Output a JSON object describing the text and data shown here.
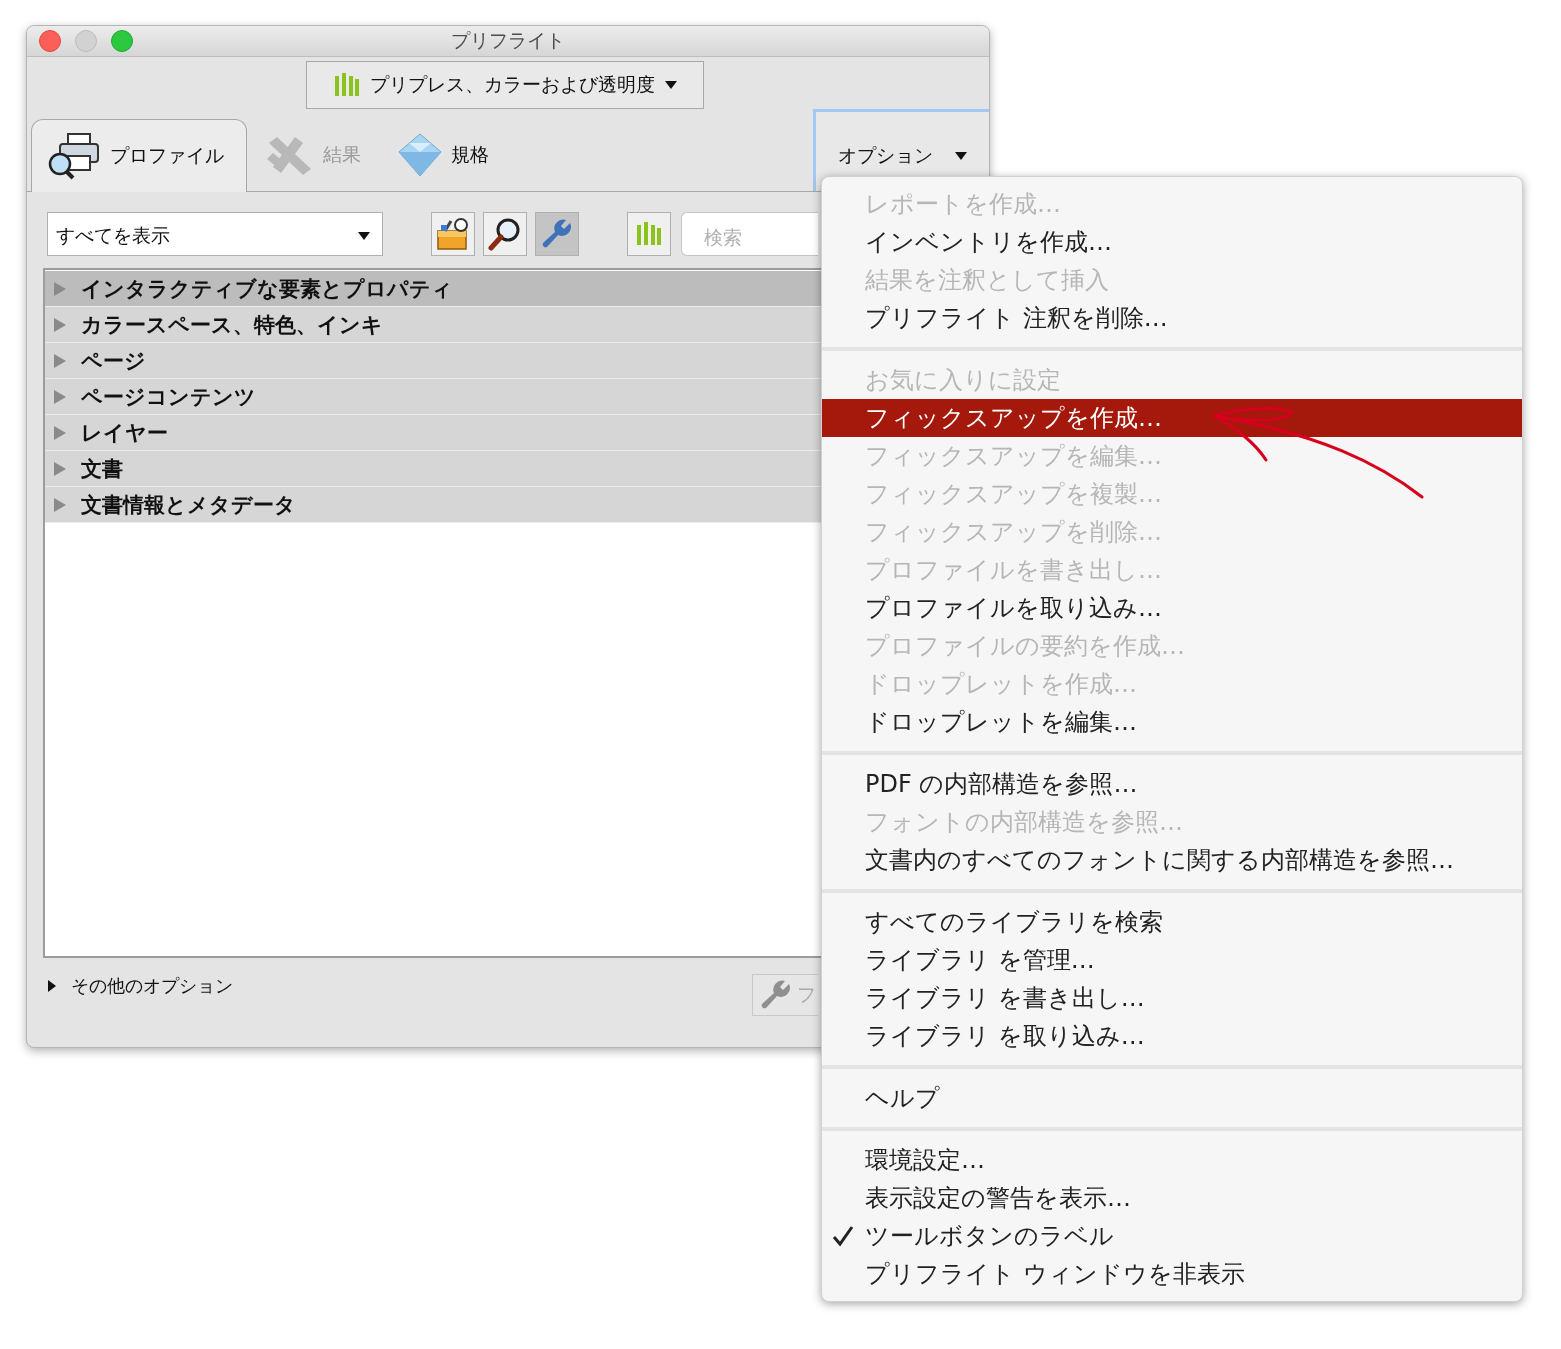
{
  "window": {
    "title": "プリフライト"
  },
  "library_selector": {
    "label": "プリプレス、カラーおよび透明度"
  },
  "tabs": [
    {
      "kind": "profiles",
      "label": "プロファイル",
      "selected": true,
      "disabled": false
    },
    {
      "kind": "results",
      "label": "結果",
      "selected": false,
      "disabled": true
    },
    {
      "kind": "standards",
      "label": "規格",
      "selected": false,
      "disabled": false
    }
  ],
  "options_button": {
    "label": "オプション",
    "expanded": true
  },
  "filter": {
    "value": "すべてを表示"
  },
  "tool_buttons": [
    {
      "kind": "toolbox",
      "selected": false
    },
    {
      "kind": "magnifier",
      "selected": false
    },
    {
      "kind": "wrench",
      "selected": true
    }
  ],
  "search": {
    "placeholder": "検索"
  },
  "tree": [
    {
      "label": "インタラクティブな要素とプロパティ",
      "selected": true
    },
    {
      "label": "カラースペース、特色、インキ",
      "selected": false
    },
    {
      "label": "ページ",
      "selected": false
    },
    {
      "label": "ページコンテンツ",
      "selected": false
    },
    {
      "label": "レイヤー",
      "selected": false
    },
    {
      "label": "文書",
      "selected": false
    },
    {
      "label": "文書情報とメタデータ",
      "selected": false
    }
  ],
  "more_options": {
    "label": "その他のオプション",
    "expanded": false
  },
  "bottom_button": {
    "label": "フ"
  },
  "menu": {
    "sections": [
      {
        "items": [
          {
            "label": "レポートを作成…",
            "disabled": true,
            "selected": false,
            "checked": false
          },
          {
            "label": "インベントリを作成…",
            "disabled": false,
            "selected": false,
            "checked": false
          },
          {
            "label": "結果を注釈として挿入",
            "disabled": true,
            "selected": false,
            "checked": false
          },
          {
            "label": "プリフライト 注釈を削除…",
            "disabled": false,
            "selected": false,
            "checked": false
          }
        ]
      },
      {
        "items": [
          {
            "label": "お気に入りに設定",
            "disabled": true,
            "selected": false,
            "checked": false
          },
          {
            "label": "フィックスアップを作成…",
            "disabled": false,
            "selected": true,
            "checked": false
          },
          {
            "label": "フィックスアップを編集…",
            "disabled": true,
            "selected": false,
            "checked": false
          },
          {
            "label": "フィックスアップを複製…",
            "disabled": true,
            "selected": false,
            "checked": false
          },
          {
            "label": "フィックスアップを削除…",
            "disabled": true,
            "selected": false,
            "checked": false
          },
          {
            "label": "プロファイルを書き出し…",
            "disabled": true,
            "selected": false,
            "checked": false
          },
          {
            "label": "プロファイルを取り込み…",
            "disabled": false,
            "selected": false,
            "checked": false
          },
          {
            "label": "プロファイルの要約を作成…",
            "disabled": true,
            "selected": false,
            "checked": false
          },
          {
            "label": "ドロップレットを作成…",
            "disabled": true,
            "selected": false,
            "checked": false
          },
          {
            "label": "ドロップレットを編集…",
            "disabled": false,
            "selected": false,
            "checked": false
          }
        ]
      },
      {
        "items": [
          {
            "label": "PDF の内部構造を参照…",
            "disabled": false,
            "selected": false,
            "checked": false
          },
          {
            "label": "フォントの内部構造を参照…",
            "disabled": true,
            "selected": false,
            "checked": false
          },
          {
            "label": "文書内のすべてのフォントに関する内部構造を参照…",
            "disabled": false,
            "selected": false,
            "checked": false
          }
        ]
      },
      {
        "items": [
          {
            "label": "すべてのライブラリを検索",
            "disabled": false,
            "selected": false,
            "checked": false
          },
          {
            "label": "ライブラリ を管理…",
            "disabled": false,
            "selected": false,
            "checked": false
          },
          {
            "label": "ライブラリ を書き出し…",
            "disabled": false,
            "selected": false,
            "checked": false
          },
          {
            "label": "ライブラリ を取り込み…",
            "disabled": false,
            "selected": false,
            "checked": false
          }
        ]
      },
      {
        "items": [
          {
            "label": "ヘルプ",
            "disabled": false,
            "selected": false,
            "checked": false
          }
        ]
      },
      {
        "items": [
          {
            "label": "環境設定…",
            "disabled": false,
            "selected": false,
            "checked": false
          },
          {
            "label": "表示設定の警告を表示…",
            "disabled": false,
            "selected": false,
            "checked": false
          },
          {
            "label": "ツールボタンのラベル",
            "disabled": false,
            "selected": false,
            "checked": true
          },
          {
            "label": "プリフライト ウィンドウを非表示",
            "disabled": false,
            "selected": false,
            "checked": false
          }
        ]
      }
    ]
  }
}
